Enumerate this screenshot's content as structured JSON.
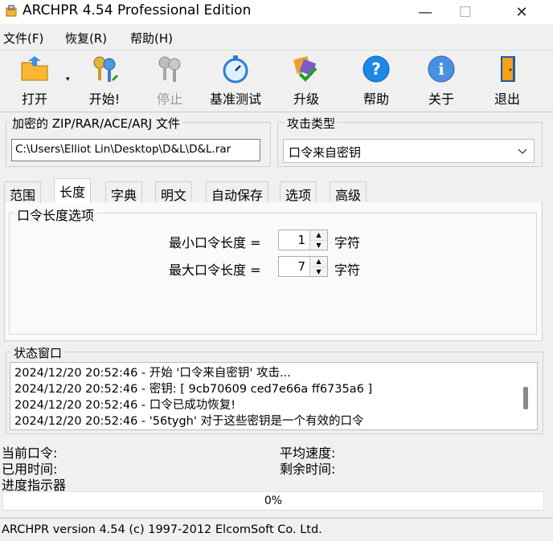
{
  "window": {
    "title": "ARCHPR 4.54 Professional Edition",
    "minimize": "—",
    "maximize": "☐",
    "close": "✕"
  },
  "menu": [
    "文件(F)",
    "恢复(R)",
    "帮助(H)"
  ],
  "toolbar": {
    "open": "打开",
    "start": "开始!",
    "stop": "停止",
    "benchmark": "基准测试",
    "upgrade": "升级",
    "help": "帮助",
    "about": "关于",
    "exit": "退出"
  },
  "encrypted_file": {
    "label": "加密的 ZIP/RAR/ACE/ARJ 文件",
    "value": "C:\\Users\\Elliot Lin\\Desktop\\D&L\\D&L.rar"
  },
  "attack_type": {
    "label": "攻击类型",
    "value": "口令来自密钥"
  },
  "tabs": [
    "范围",
    "长度",
    "字典",
    "明文",
    "自动保存",
    "选项",
    "高级"
  ],
  "active_tab": "长度",
  "length_options": {
    "title": "口令长度选项",
    "min_label": "最小口令长度 =",
    "min_value": "1",
    "max_label": "最大口令长度 =",
    "max_value": "7",
    "unit": "字符"
  },
  "status_window": {
    "title": "状态窗口",
    "lines": [
      "2024/12/20 20:52:46 - 开始 '口令来自密钥' 攻击...",
      "2024/12/20 20:52:46 - 密钥: [ 9cb70609 ced7e66a ff6735a6 ]",
      "2024/12/20 20:52:46 - 口令已成功恢复!",
      "2024/12/20 20:52:46 - '56tygh' 对于这些密钥是一个有效的口令"
    ]
  },
  "info": {
    "current_password": "当前口令:",
    "elapsed_time": "已用时间:",
    "progress_indicator": "进度指示器",
    "avg_speed": "平均速度:",
    "remaining_time": "剩余时间:"
  },
  "progress": {
    "text": "0%",
    "fraction": 0
  },
  "statusbar": "ARCHPR version 4.54 (c) 1997-2012 ElcomSoft Co. Ltd.",
  "colors": {
    "progress_fill": "#06b025"
  }
}
